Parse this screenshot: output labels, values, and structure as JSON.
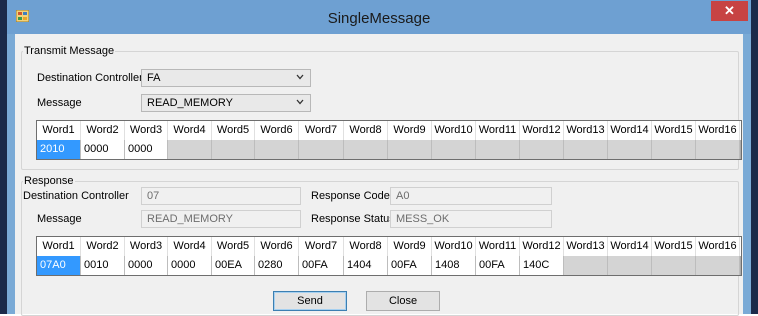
{
  "window": {
    "title": "SingleMessage",
    "close_glyph": "✕"
  },
  "transmit": {
    "group_label": "Transmit Message",
    "dest_label": "Destination Controller",
    "dest_value": "FA",
    "msg_label": "Message",
    "msg_value": "READ_MEMORY",
    "headers": [
      "Word1",
      "Word2",
      "Word3",
      "Word4",
      "Word5",
      "Word6",
      "Word7",
      "Word8",
      "Word9",
      "Word10",
      "Word11",
      "Word12",
      "Word13",
      "Word14",
      "Word15",
      "Word16"
    ],
    "values": [
      "2010",
      "0000",
      "0000",
      "",
      "",
      "",
      "",
      "",
      "",
      "",
      "",
      "",
      "",
      "",
      "",
      ""
    ]
  },
  "response": {
    "group_label": "Response",
    "dest_label": "Destination Controller",
    "dest_value": "07",
    "msg_label": "Message",
    "msg_value": "READ_MEMORY",
    "code_label": "Response Code",
    "code_value": "A0",
    "status_label": "Response Status",
    "status_value": "MESS_OK",
    "headers": [
      "Word1",
      "Word2",
      "Word3",
      "Word4",
      "Word5",
      "Word6",
      "Word7",
      "Word8",
      "Word9",
      "Word10",
      "Word11",
      "Word12",
      "Word13",
      "Word14",
      "Word15",
      "Word16"
    ],
    "values": [
      "07A0",
      "0010",
      "0000",
      "0000",
      "00EA",
      "0280",
      "00FA",
      "1404",
      "00FA",
      "1408",
      "00FA",
      "140C",
      "",
      "",
      "",
      ""
    ]
  },
  "buttons": {
    "send": "Send",
    "close": "Close"
  },
  "colors": {
    "titlebar": "#6ea0d2",
    "selection": "#3399ff",
    "close": "#c74343"
  }
}
